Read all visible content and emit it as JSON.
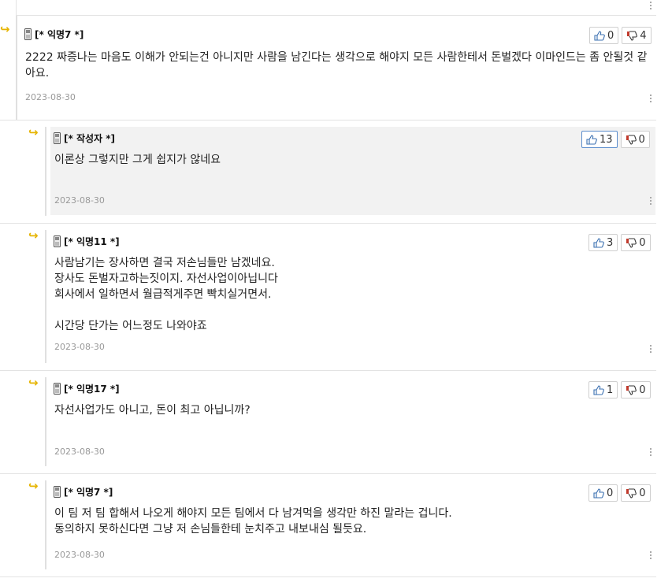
{
  "comments": [
    {
      "author": "[* 익명7 *]",
      "text": "2222 짜증나는 마음도 이해가 안되는건 아니지만 사람을 남긴다는 생각으로 해야지 모든 사람한테서 돈벌겠다 이마인드는 좀 안될것 같아요.",
      "date": "2023-08-30",
      "likes": "0",
      "dislikes": "4"
    },
    {
      "author": "[* 작성자 *]",
      "text": "이론상 그렇지만 그게 쉽지가 않네요",
      "date": "2023-08-30",
      "likes": "13",
      "dislikes": "0"
    },
    {
      "author": "[* 익명11 *]",
      "text": "사람남기는 장사하면 결국 저손님들만 남겠네요.\n장사도 돈벌자고하는짓이지. 자선사업이아닙니다\n회사에서 일하면서 월급적게주면 빡치실거면서.\n\n시간당 단가는 어느정도 나와야죠",
      "date": "2023-08-30",
      "likes": "3",
      "dislikes": "0"
    },
    {
      "author": "[* 익명17 *]",
      "text": "자선사업가도 아니고, 돈이 최고 아닙니까?",
      "date": "2023-08-30",
      "likes": "1",
      "dislikes": "0"
    },
    {
      "author": "[* 익명7 *]",
      "text": "이 팀 저 팀 합해서 나오게 해야지 모든 팀에서 다 남겨먹을 생각만 하진 말라는 겁니다.\n동의하지 못하신다면 그냥 저 손님들한테 눈치주고 내보내심 될듯요.",
      "date": "2023-08-30",
      "likes": "0",
      "dislikes": "0"
    }
  ],
  "icons": {
    "reply": "reply-arrow-icon",
    "device": "mobile-phone-icon",
    "like": "thumbs-up-icon",
    "dislike": "thumbs-down-icon",
    "more": "more-vertical-icon"
  },
  "colors": {
    "reply_arrow": "#e6b400",
    "highlight_bg": "#f2f2f2",
    "date": "#999999",
    "like_highlight_border": "#5a8ccc",
    "dislike_red": "#c0392b"
  }
}
